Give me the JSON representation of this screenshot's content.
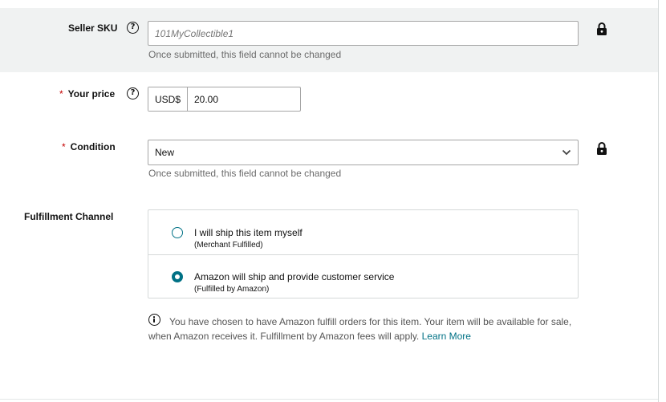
{
  "seller_sku": {
    "label": "Seller SKU",
    "value": "101MyCollectible1",
    "hint": "Once submitted, this field cannot be changed"
  },
  "your_price": {
    "required_marker": "*",
    "label": "Your price",
    "currency": "USD$",
    "value": "20.00"
  },
  "condition": {
    "required_marker": "*",
    "label": "Condition",
    "selected": "New",
    "hint": "Once submitted, this field cannot be changed"
  },
  "fulfillment": {
    "label": "Fulfillment Channel",
    "options": [
      {
        "title": "I will ship this item myself",
        "subtitle": "(Merchant Fulfilled)",
        "selected": false
      },
      {
        "title": "Amazon will ship and provide customer service",
        "subtitle": "(Fulfilled by Amazon)",
        "selected": true
      }
    ],
    "info_text": "You have chosen to have Amazon fulfill orders for this item. Your item will be available for sale, when Amazon receives it. Fulfillment by Amazon fees will apply.",
    "learn_more": "Learn More"
  },
  "colors": {
    "accent": "#007185",
    "required": "#c40000",
    "locked_row_bg": "#f0f2f2"
  }
}
